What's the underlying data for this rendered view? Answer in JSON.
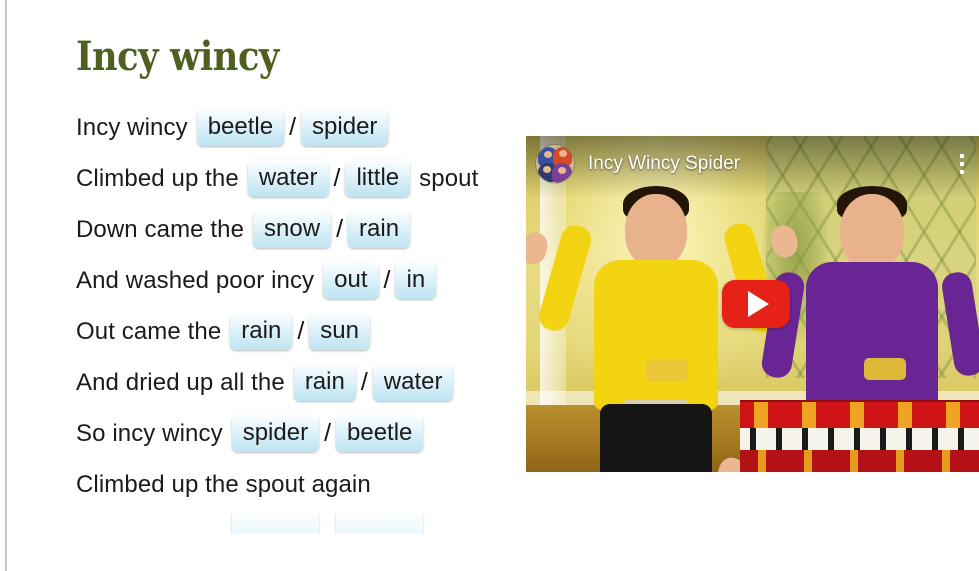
{
  "page": {
    "title": "Incy wincy",
    "title_color": "#4f5f20",
    "background": "#ffffff"
  },
  "worksheet": {
    "separator": "/",
    "lines": [
      {
        "lead": "Incy wincy",
        "options": [
          "beetle",
          "spider"
        ],
        "tail": ""
      },
      {
        "lead": "Climbed up the",
        "options": [
          "water",
          "little"
        ],
        "tail": "spout"
      },
      {
        "lead": "Down came the",
        "options": [
          "snow",
          "rain"
        ],
        "tail": ""
      },
      {
        "lead": "And washed poor incy",
        "options": [
          "out",
          "in"
        ],
        "tail": ""
      },
      {
        "lead": "Out came the",
        "options": [
          "rain",
          "sun"
        ],
        "tail": ""
      },
      {
        "lead": "And dried up all the",
        "options": [
          "rain",
          "water"
        ],
        "tail": ""
      },
      {
        "lead": "So incy wincy",
        "options": [
          "spider",
          "beetle"
        ],
        "tail": ""
      },
      {
        "lead": "Climbed up the spout again",
        "options": [],
        "tail": ""
      }
    ],
    "chip_color_top": "#fbfeff",
    "chip_color_bottom": "#bfe4f1",
    "text_color": "#1b1b1b"
  },
  "video": {
    "title": "Incy Wincy Spider",
    "play_button_color": "#e62117",
    "icons": {
      "avatar": "channel-avatar",
      "menu": "more-vertical-icon",
      "play": "play-icon"
    },
    "thumbnail": {
      "description": "Two performers on a yellow-green set, one in a yellow shirt with arms raised and one in a purple shirt playing a red star-covered keyboard",
      "performer_left_shirt": "#f2d413",
      "performer_right_shirt": "#6a2594",
      "keyboard_color": "#cf1418"
    }
  }
}
